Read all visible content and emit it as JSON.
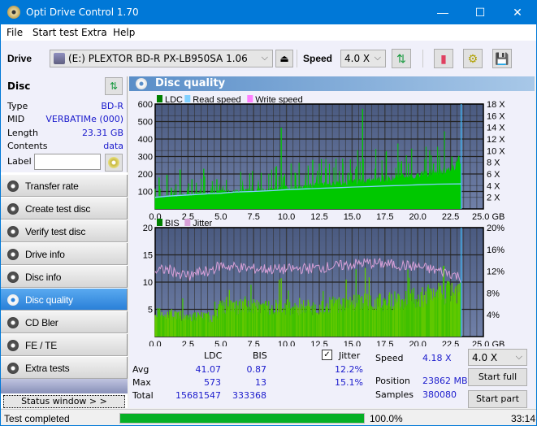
{
  "window": {
    "title": "Opti Drive Control 1.70",
    "minimize_icon": "minimize-icon",
    "maximize_icon": "maximize-icon",
    "close_icon": "close-icon"
  },
  "menu": [
    "File",
    "Start test",
    "Extra",
    "Help"
  ],
  "toolbar": {
    "drive_label": "Drive",
    "drive_value": "(E:)  PLEXTOR BD-R  PX-LB950SA 1.06",
    "speed_label": "Speed",
    "speed_value": "4.0 X",
    "icons": [
      "drive-icon",
      "eject-icon",
      "refresh-icon",
      "erase-icon",
      "settings-icon",
      "save-icon"
    ]
  },
  "disc": {
    "header": "Disc",
    "rows": [
      {
        "key": "Type",
        "value": "BD-R"
      },
      {
        "key": "MID",
        "value": "VERBATIMe (000)"
      },
      {
        "key": "Length",
        "value": "23.31 GB"
      },
      {
        "key": "Contents",
        "value": "data"
      }
    ],
    "label_key": "Label",
    "label_value": ""
  },
  "nav": [
    {
      "label": "Transfer rate",
      "active": false
    },
    {
      "label": "Create test disc",
      "active": false
    },
    {
      "label": "Verify test disc",
      "active": false
    },
    {
      "label": "Drive info",
      "active": false
    },
    {
      "label": "Disc info",
      "active": false
    },
    {
      "label": "Disc quality",
      "active": true
    },
    {
      "label": "CD Bler",
      "active": false
    },
    {
      "label": "FE / TE",
      "active": false
    },
    {
      "label": "Extra tests",
      "active": false
    }
  ],
  "status_window_label": "Status window > >",
  "panel_title": "Disc quality",
  "colors": {
    "ldc": "#00c800",
    "read_speed": "#80d0ff",
    "write_speed": "#ff80ff",
    "bis": "#00a000",
    "jitter": "#d8a0d8",
    "plot_bg_top": "#4a5a80",
    "plot_bg_bottom": "#7080a8",
    "accent": "#0078d7",
    "progress": "#06b025"
  },
  "chart_data": [
    {
      "type": "area",
      "title": "LDC / Read speed",
      "legend": [
        "LDC",
        "Read speed",
        "Write speed"
      ],
      "legend_position": "top-left",
      "xlabel": "GB",
      "x_ticks": [
        "0.0",
        "2.5",
        "5.0",
        "7.5",
        "10.0",
        "12.5",
        "15.0",
        "17.5",
        "20.0",
        "22.5",
        "25.0 GB"
      ],
      "xlim": [
        0,
        25
      ],
      "y_left_ticks": [
        "100",
        "200",
        "300",
        "400",
        "500",
        "600"
      ],
      "ylim_left": [
        0,
        600
      ],
      "y_right_ticks": [
        "2 X",
        "4 X",
        "6 X",
        "8 X",
        "10 X",
        "12 X",
        "14 X",
        "16 X",
        "18 X"
      ],
      "ylim_right": [
        0,
        18
      ],
      "grid": true,
      "end_marker_x": 23.31,
      "series": [
        {
          "name": "LDC baseline",
          "x": [
            0,
            2.5,
            5,
            7.5,
            10,
            12.5,
            15,
            17.5,
            20,
            22.5,
            23.3
          ],
          "values": [
            65,
            80,
            95,
            105,
            120,
            135,
            150,
            170,
            190,
            220,
            280
          ]
        },
        {
          "name": "LDC spikes",
          "x": [
            0.3,
            0.9,
            1.9,
            2.8,
            3.7,
            4.7,
            9.6,
            12.0,
            14.3,
            15.8,
            17.6,
            19.3,
            21.2,
            22.6,
            23.0
          ],
          "values": [
            180,
            195,
            225,
            170,
            230,
            170,
            465,
            280,
            260,
            573,
            210,
            260,
            260,
            300,
            240
          ]
        },
        {
          "name": "Read speed",
          "unit": "X",
          "x": [
            0,
            1,
            2.5,
            4,
            5,
            6,
            7.5,
            9,
            10,
            11.5,
            12.5,
            14,
            15,
            16.5,
            17.5,
            19,
            20,
            21.5,
            23.3
          ],
          "values": [
            2.0,
            2.2,
            2.4,
            2.6,
            2.7,
            2.9,
            3.0,
            3.15,
            3.3,
            3.45,
            3.55,
            3.65,
            3.75,
            3.85,
            3.95,
            4.05,
            4.15,
            4.25,
            4.3
          ]
        }
      ]
    },
    {
      "type": "area",
      "title": "BIS / Jitter",
      "legend": [
        "BIS",
        "Jitter"
      ],
      "legend_position": "top-left",
      "xlabel": "GB",
      "x_ticks": [
        "0.0",
        "2.5",
        "5.0",
        "7.5",
        "10.0",
        "12.5",
        "15.0",
        "17.5",
        "20.0",
        "22.5",
        "25.0 GB"
      ],
      "xlim": [
        0,
        25
      ],
      "y_left_ticks": [
        "5",
        "10",
        "15",
        "20"
      ],
      "ylim_left": [
        0,
        20
      ],
      "y_right_ticks": [
        "4%",
        "8%",
        "12%",
        "16%",
        "20%"
      ],
      "ylim_right": [
        0,
        20
      ],
      "grid": true,
      "end_marker_x": 23.31,
      "series": [
        {
          "name": "BIS",
          "x": [
            0,
            2.5,
            4.5,
            5,
            7.5,
            10,
            12.5,
            15,
            17.5,
            20,
            22.5,
            23.3
          ],
          "values": [
            5,
            4,
            4,
            6,
            6,
            6,
            6,
            7,
            7,
            8,
            9,
            9
          ]
        },
        {
          "name": "Jitter",
          "unit": "%",
          "x": [
            0,
            1,
            2,
            2.5,
            3.5,
            4.5,
            5,
            7.5,
            10,
            12.5,
            15,
            16,
            17.5,
            20,
            22.5,
            23.3
          ],
          "values": [
            12.0,
            12.3,
            11.5,
            11.2,
            11.8,
            12.5,
            13.0,
            12.4,
            12.3,
            12.6,
            13.2,
            13.5,
            13.3,
            12.8,
            11.6,
            10.8
          ]
        }
      ]
    }
  ],
  "stats": {
    "col_ldc": "LDC",
    "col_bis": "BIS",
    "rows": [
      {
        "label": "Avg",
        "ldc": "41.07",
        "bis": "0.87",
        "jitter": "12.2%"
      },
      {
        "label": "Max",
        "ldc": "573",
        "bis": "13",
        "jitter": "15.1%"
      },
      {
        "label": "Total",
        "ldc": "15681547",
        "bis": "333368"
      }
    ],
    "jitter_label": "Jitter",
    "jitter_checked": true,
    "speed_label": "Speed",
    "speed_value": "4.18 X",
    "position_label": "Position",
    "position_value": "23862 MB",
    "samples_label": "Samples",
    "samples_value": "380080",
    "speed_select": "4.0 X",
    "start_full": "Start full",
    "start_part": "Start part"
  },
  "statusbar": {
    "text": "Test completed",
    "progress_percent": 100.0,
    "progress_label": "100.0%",
    "time": "33:14"
  }
}
